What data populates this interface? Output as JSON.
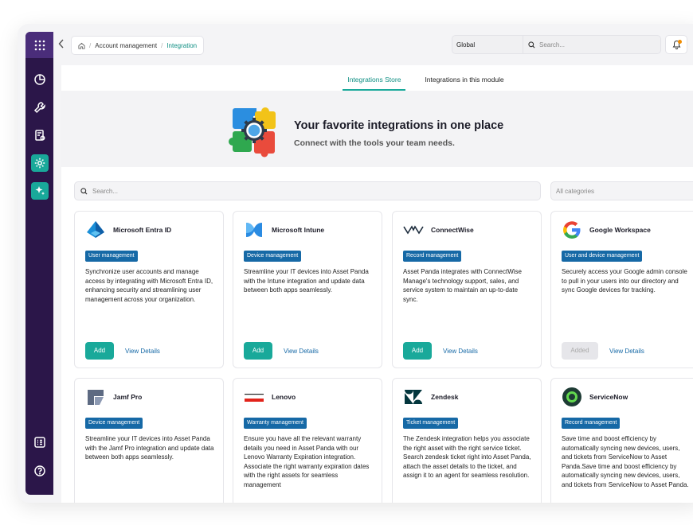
{
  "breadcrumb": {
    "root": "Account management",
    "current": "Integration"
  },
  "topbar": {
    "scope": "Global",
    "search_placeholder": "Search..."
  },
  "tabs": [
    {
      "label": "Integrations Store",
      "active": true
    },
    {
      "label": "Integrations in this module",
      "active": false
    }
  ],
  "hero": {
    "title": "Your favorite integrations in one place",
    "subtitle": "Connect with the tools your team needs."
  },
  "search": {
    "placeholder": "Search..."
  },
  "categories": {
    "selected": "All categories"
  },
  "cards": [
    {
      "name": "Microsoft Entra ID",
      "tag": "User management",
      "icon": "microsoft-entra-icon",
      "description": "Synchronize user accounts and manage access by integrating with Microsoft Entra ID, enhancing security and streamlining user management across your organization.",
      "action": "Add",
      "details": "View Details"
    },
    {
      "name": "Microsoft Intune",
      "tag": "Device management",
      "icon": "microsoft-intune-icon",
      "description": "Streamline your IT devices into Asset Panda with the Intune integration and update data between both apps seamlessly.",
      "action": "Add",
      "details": "View Details"
    },
    {
      "name": "ConnectWise",
      "tag": "Record management",
      "icon": "connectwise-icon",
      "description": "Asset Panda integrates with ConnectWise Manage's technology support, sales, and service system to maintain an up-to-date sync.",
      "action": "Add",
      "details": "View Details"
    },
    {
      "name": "Google Workspace",
      "tag": "User and device management",
      "icon": "google-icon",
      "description": "Securely access your Google admin console to pull in your users into our directory and sync Google devices for tracking.",
      "action": "Added",
      "details": "View Details"
    },
    {
      "name": "Jamf Pro",
      "tag": "Device management",
      "icon": "jamf-icon",
      "description": "Streamline your IT devices into Asset Panda with the Jamf Pro integration and update data between both apps seamlessly."
    },
    {
      "name": "Lenovo",
      "tag": "Warranty management",
      "icon": "lenovo-icon",
      "description": "Ensure you have all the relevant warranty details you need in Asset Panda with our Lenovo Warranty Expiration integration. Associate the right warranty expiration dates with the right assets for seamless management"
    },
    {
      "name": "Zendesk",
      "tag": "Ticket management",
      "icon": "zendesk-icon",
      "description": "The Zendesk integration helps you associate the right asset with the right service ticket. Search zendesk ticket right into Asset Panda, attach the asset details to the ticket, and assign it to an agent for seamless resolution."
    },
    {
      "name": "ServiceNow",
      "tag": "Record management",
      "icon": "servicenow-icon",
      "description": "Save time and boost efficiency by automatically syncing new devices, users, and tickets from ServiceNow to Asset Panda.Save time and boost efficiency by automatically syncing new devices, users, and tickets from ServiceNow to Asset Panda."
    }
  ],
  "colors": {
    "accent": "#19a99a",
    "sidebar": "#2b1649",
    "tag": "#1669a6",
    "link": "#1669a6"
  }
}
